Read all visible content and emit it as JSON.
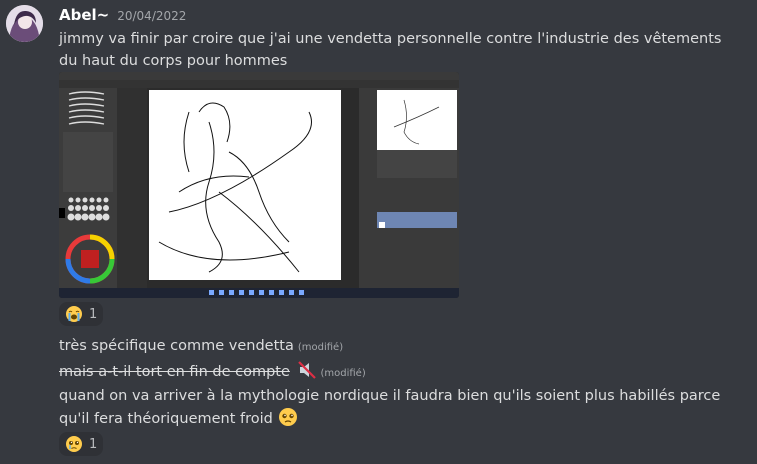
{
  "message1": {
    "username": "Abel~",
    "timestamp": "20/04/2022",
    "text": "jimmy va finir par croire que j'ai une vendetta personnelle contre l'industrie des vêtements du haut du corps pour hommes"
  },
  "reactions": [
    {
      "emoji": "loudly-crying-face",
      "count": "1"
    },
    {
      "emoji": "pleading-face",
      "count": "1"
    }
  ],
  "message2": {
    "text": "très spécifique comme vendetta",
    "edited": "(modifié)"
  },
  "message3": {
    "text": "mais a-t-il tort en fin de compte",
    "edited": "(modifié)"
  },
  "message4": {
    "text": "quand on va arriver à la mythologie nordique il faudra bien qu'ils soient plus habillés parce qu'il fera théoriquement froid"
  },
  "colors": {
    "background": "#36393f",
    "reaction_bg": "#2f3136",
    "text": "#dcddde",
    "muted": "#a3a6aa"
  }
}
